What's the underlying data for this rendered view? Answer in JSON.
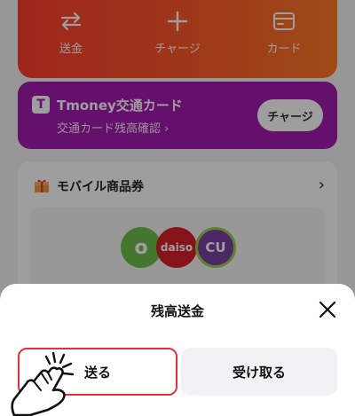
{
  "actions": {
    "send_label": "送金",
    "charge_label": "チャージ",
    "card_label": "カード"
  },
  "tmoney": {
    "title": "Tmoney交通カード",
    "subtitle": "交通カード残高確認 ›",
    "button_label": "チャージ",
    "logo_letter": "T"
  },
  "mobile_voucher": {
    "title": "モバイル商品券",
    "brands": [
      "daiso",
      "CU"
    ]
  },
  "sheet": {
    "title": "残高送金",
    "tabs": {
      "send_label": "送る",
      "receive_label": "受け取る"
    }
  },
  "colors": {
    "accent_orange": "#ff5a2a",
    "tmoney_purple": "#a51ab0",
    "highlight_red": "#e6303a"
  }
}
